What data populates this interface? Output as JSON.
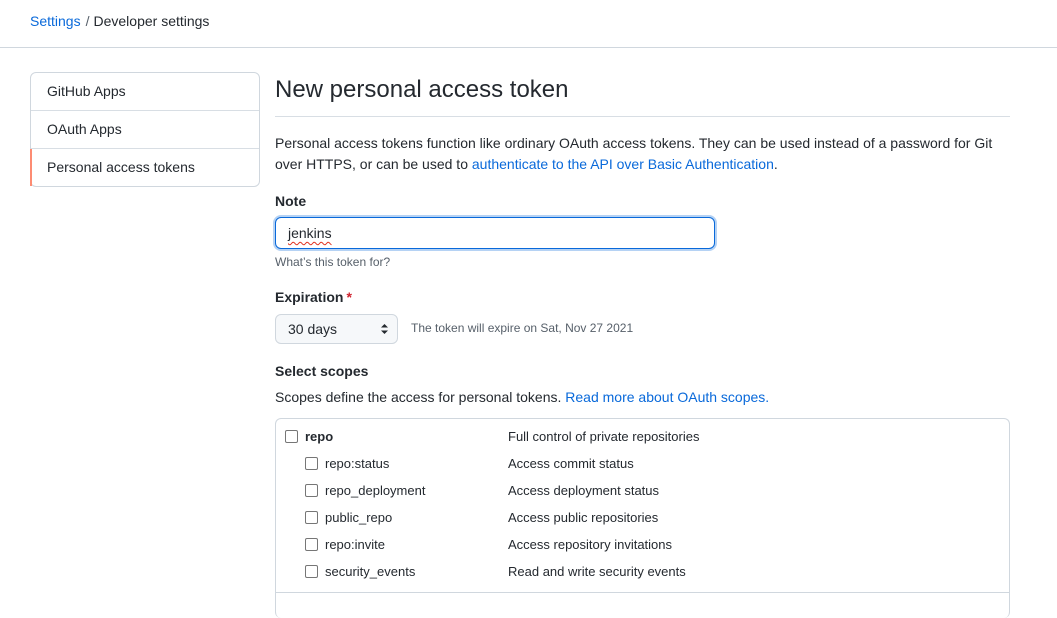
{
  "breadcrumb": {
    "root": "Settings",
    "separator": "/",
    "current": "Developer settings"
  },
  "sidebar": {
    "items": [
      {
        "label": "GitHub Apps",
        "selected": false
      },
      {
        "label": "OAuth Apps",
        "selected": false
      },
      {
        "label": "Personal access tokens",
        "selected": true
      }
    ]
  },
  "main": {
    "title": "New personal access token",
    "intro_text": "Personal access tokens function like ordinary OAuth access tokens. They can be used instead of a password for Git over HTTPS, or can be used to ",
    "intro_link": "authenticate to the API over Basic Authentication",
    "intro_end": ".",
    "note": {
      "label": "Note",
      "value": "jenkins",
      "hint": "What’s this token for?"
    },
    "expiration": {
      "label": "Expiration",
      "required_mark": "*",
      "selected": "30 days",
      "note": "The token will expire on Sat, Nov 27 2021"
    },
    "scopes": {
      "label": "Select scopes",
      "description": "Scopes define the access for personal tokens. ",
      "link": "Read more about OAuth scopes.",
      "items": [
        {
          "name": "repo",
          "description": "Full control of private repositories",
          "checked": false
        },
        {
          "name": "repo:status",
          "description": "Access commit status",
          "checked": false
        },
        {
          "name": "repo_deployment",
          "description": "Access deployment status",
          "checked": false
        },
        {
          "name": "public_repo",
          "description": "Access public repositories",
          "checked": false
        },
        {
          "name": "repo:invite",
          "description": "Access repository invitations",
          "checked": false
        },
        {
          "name": "security_events",
          "description": "Read and write security events",
          "checked": false
        }
      ]
    }
  },
  "colors": {
    "link": "#0969da",
    "border": "#d0d7de",
    "selected_marker": "#fd8c73",
    "required": "#cf222e",
    "focus_ring": "#0969da"
  },
  "icons": {
    "select_arrows": "chevron-up-down-icon",
    "checkbox": "checkbox-icon"
  }
}
